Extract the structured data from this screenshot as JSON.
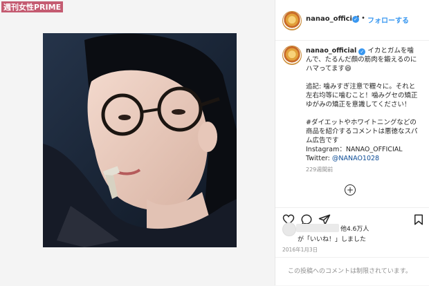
{
  "watermark": "週刊女性PRIME",
  "header": {
    "username": "nanao_official",
    "separator": "•",
    "follow_label": "フォローする"
  },
  "caption": {
    "username": "nanao_official",
    "text_main": "イカとガムを噛んで、たるんだ顔の筋肉を鍛えるのにハマってます😆",
    "text_note": "追記: 噛みすぎ注意で糎々に。それと左右均等に噛むこと！噛みグセの矯正ゆがみの矯正を意識してください！",
    "text_hashtag": "#ダイエットやホワイトニングなどの商品を紹介するコメントは悪徳なスパム広告です",
    "instagram_line": "Instagram：NANAO_OFFICIAL",
    "twitter_label": "Twitter: ",
    "twitter_handle": "@NANAO1028",
    "time_ago": "229週間前"
  },
  "likes": {
    "others": "他4.6万人",
    "suffix": "が「いいね！」しました"
  },
  "date": "2016年1月3日",
  "comments": {
    "disabled_text": "この投稿へのコメントは制限されています。"
  },
  "icons": {
    "heart": "heart-icon",
    "comment": "comment-icon",
    "share": "share-icon",
    "bookmark": "bookmark-icon",
    "plus": "plus-circle-icon",
    "verified": "verified-badge-icon"
  },
  "colors": {
    "accent": "#3897f0",
    "link": "#0b4b95",
    "muted": "#8e8e8e"
  }
}
